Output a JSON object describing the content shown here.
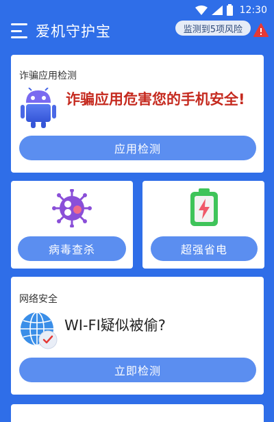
{
  "status_bar": {
    "time": "12:30",
    "icons": [
      "wifi-icon",
      "signal-icon",
      "battery-icon"
    ]
  },
  "header": {
    "title": "爱机守护宝",
    "risk_text": "监测到5项风险",
    "risk_icon": "warning-icon",
    "menu_icon": "menu-icon"
  },
  "fraud_card": {
    "label": "诈骗应用检测",
    "warning": "诈骗应用危害您的手机安全!",
    "button": "应用检测",
    "icon": "android-robot-icon"
  },
  "virus_card": {
    "button": "病毒查杀",
    "icon": "virus-icon"
  },
  "power_card": {
    "button": "超强省电",
    "icon": "battery-charge-icon"
  },
  "network_card": {
    "label": "网络安全",
    "question": "WI-FI疑似被偷?",
    "button": "立即检测",
    "icon": "globe-shield-icon"
  },
  "colors": {
    "background": "#2f6ee8",
    "button": "#5b8ef0",
    "warning_text": "#c52a1f",
    "alert": "#e53935"
  }
}
